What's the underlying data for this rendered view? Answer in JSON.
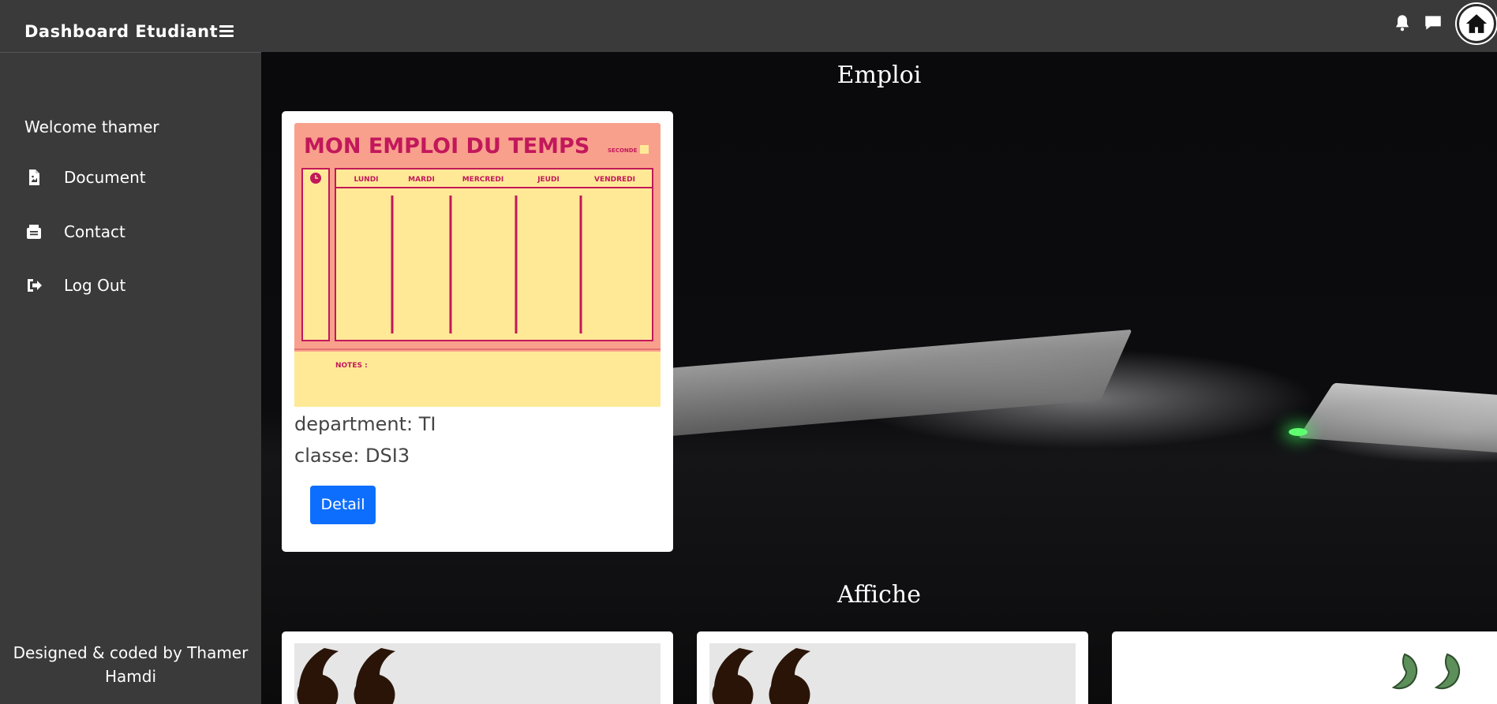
{
  "header": {
    "brand": "Dashboard Etudiant",
    "icons": [
      "menu-icon",
      "bell-icon",
      "chat-icon",
      "home-icon"
    ]
  },
  "sidebar": {
    "welcome": "Welcome thamer",
    "items": [
      {
        "label": "Document",
        "icon": "document-icon"
      },
      {
        "label": "Contact",
        "icon": "contact-icon"
      },
      {
        "label": "Log Out",
        "icon": "logout-icon"
      }
    ],
    "credit": "Designed & coded by Thamer Hamdi"
  },
  "main": {
    "emploi_title": "Emploi",
    "affiche_title": "Affiche",
    "emploi_card": {
      "image": {
        "title": "MON EMPLOI DU TEMPS",
        "tag": "SECONDE",
        "days": [
          "LUNDI",
          "MARDI",
          "MERCREDI",
          "JEUDI",
          "VENDREDI"
        ],
        "notes": "NOTES :"
      },
      "department": "department: TI",
      "classe": "classe: DSI3",
      "button": "Detail"
    }
  },
  "colors": {
    "sidebar_bg": "#3a3a3a",
    "button_blue": "#0d6efd",
    "schedule_pink": "#f9a08c",
    "schedule_yellow": "#ffe996",
    "schedule_accent": "#c2185b",
    "quote_brown": "#2a1408",
    "quote_green": "#5c8f5a"
  }
}
